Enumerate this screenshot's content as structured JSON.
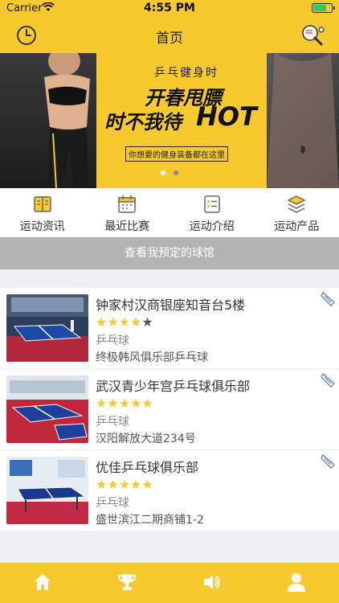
{
  "status": {
    "carrier": "Carrier",
    "time": "4:55 PM",
    "battery_level": 0.75,
    "battery_color": "#3ac84a"
  },
  "theme": {
    "primary": "#f6c92f",
    "booked_bg": "#b3b3b3",
    "star_on": "#f6c92f",
    "star_off": "#555555"
  },
  "nav": {
    "title": "首页",
    "left_icon": "clock-icon",
    "right_icon": "ping-pong-paddle-icon"
  },
  "banner": {
    "subtitle": "乒乓健身时",
    "line1": "开春甩膘",
    "line2": "时不我待",
    "hot": "HOT",
    "tagline": "你想要的健身装备都在这里",
    "pages": 2,
    "active_page": 0
  },
  "categories": [
    {
      "label": "运动资讯",
      "icon": "book-icon"
    },
    {
      "label": "最近比赛",
      "icon": "calendar-icon"
    },
    {
      "label": "运动介绍",
      "icon": "list-doc-icon"
    },
    {
      "label": "运动产品",
      "icon": "layers-icon"
    }
  ],
  "booked": {
    "label": "查看我预定的球馆"
  },
  "venues": [
    {
      "name": "钟家村汉商银座知音台5楼",
      "rating": 4,
      "max_rating": 5,
      "type": "乒乓球",
      "address": "终极韩风俱乐部乒乓球"
    },
    {
      "name": "武汉青少年宫乒乓球俱乐部",
      "rating": 5,
      "max_rating": 5,
      "type": "乒乓球",
      "address": "汉阳解放大道234号"
    },
    {
      "name": "优佳乒乓球俱乐部",
      "rating": 5,
      "max_rating": 5,
      "type": "乒乓球",
      "address": "盛世滨江二期商铺1-2"
    }
  ],
  "tabs": [
    {
      "icon": "home-icon"
    },
    {
      "icon": "trophy-icon"
    },
    {
      "icon": "speaker-icon"
    },
    {
      "icon": "user-icon"
    }
  ]
}
